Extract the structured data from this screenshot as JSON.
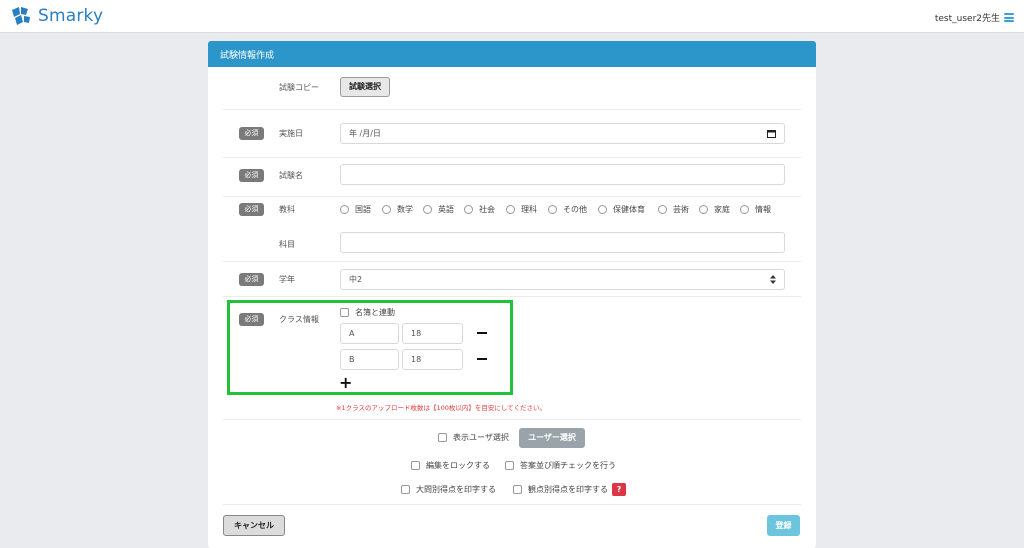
{
  "brand": {
    "name": "Smarky",
    "color": "#2a7fc0"
  },
  "user": {
    "name": "test_user2先生",
    "menu_icon": "hamburger-icon"
  },
  "card": {
    "title": "試験情報作成",
    "header_color": "#2c95c9"
  },
  "required_label": "必須",
  "exam_copy": {
    "label": "試験コピー",
    "button": "試験選択"
  },
  "date": {
    "label": "実施日",
    "placeholder": "年 /月/日"
  },
  "exam_name": {
    "label": "試験名",
    "value": ""
  },
  "subject": {
    "label": "教科",
    "options": [
      "国語",
      "数学",
      "英語",
      "社会",
      "理科",
      "その他",
      "保健体育",
      "芸術",
      "家庭",
      "情報"
    ]
  },
  "course": {
    "label": "科目",
    "value": ""
  },
  "grade": {
    "label": "学年",
    "value": "中2"
  },
  "class_info": {
    "label": "クラス情報",
    "link_checkbox": "名簿と連動",
    "rows": [
      {
        "name": "A",
        "count": "18"
      },
      {
        "name": "B",
        "count": "18"
      }
    ],
    "note": "※1クラスのアップロード枚数は【100枚以内】を目安にしてください。"
  },
  "display_user": {
    "label": "表示ユーザ選択",
    "button": "ユーザー選択"
  },
  "options": {
    "lock_edit": "編集をロックする",
    "answer_order": "答案並び順チェックを行う",
    "print_question": "大問別得点を印字する",
    "print_perspective": "観点別得点を印字する",
    "help": "?"
  },
  "actions": {
    "cancel": "キャンセル",
    "submit": "登録"
  },
  "colors": {
    "highlight": "#22c13d",
    "note": "#e23b3b",
    "submit": "#6cc5dc",
    "help": "#dc3545"
  }
}
